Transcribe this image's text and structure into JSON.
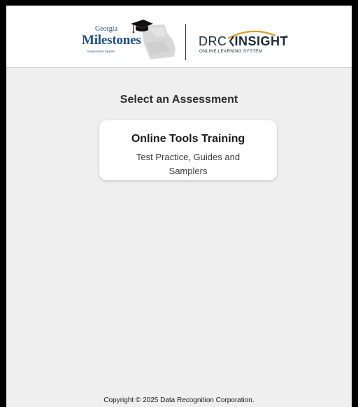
{
  "header": {
    "gm_logo": {
      "line1": "Georgia",
      "line2": "Milestones",
      "line3": "Assessment System"
    },
    "drc_logo": {
      "drc": "DRC",
      "insight": "INSIGHT",
      "tm": "™",
      "subtitle": "ONLINE LEARNING SYSTEM"
    }
  },
  "main": {
    "title": "Select an Assessment",
    "cards": [
      {
        "title": "Online Tools Training",
        "description": "Test Practice, Guides and Samplers"
      }
    ]
  },
  "footer": {
    "copyright": "Copyright © 2025 Data Recognition Corporation."
  },
  "colors": {
    "background": "#efefef",
    "header": "#ffffff",
    "gm_blue": "#1d4f8c",
    "drc_gold": "#d9a12a",
    "drc_dark": "#1b2a3a"
  }
}
